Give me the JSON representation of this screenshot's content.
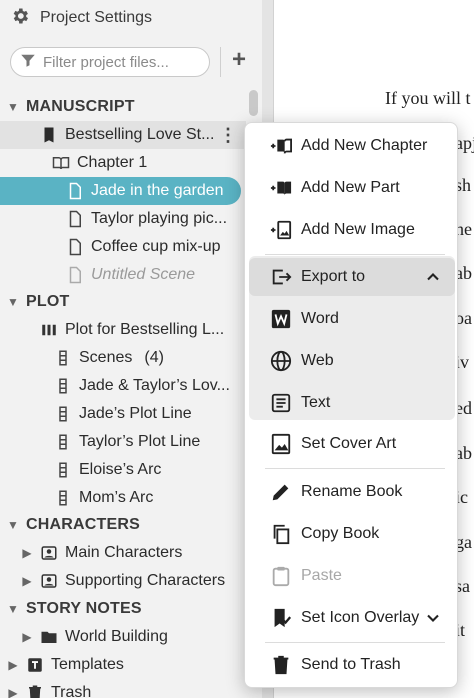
{
  "header": {
    "title": "Project Settings",
    "icon": "gear-icon"
  },
  "filter": {
    "placeholder": "Filter project files...",
    "add_label": "+"
  },
  "tree": {
    "manuscript": {
      "label": "MANUSCRIPT",
      "book": "Bestselling Love St...",
      "chapter": "Chapter 1",
      "scenes": [
        "Jade in the garden",
        "Taylor playing pic...",
        "Coffee cup mix-up",
        "Untitled Scene"
      ]
    },
    "plot": {
      "label": "PLOT",
      "board": "Plot for Bestselling L...",
      "lines": [
        "Scenes",
        "Jade & Taylor’s Lov...",
        "Jade’s Plot Line",
        "Taylor’s Plot Line",
        "Eloise’s Arc",
        "Mom’s Arc"
      ],
      "scenes_count": "(4)"
    },
    "characters": {
      "label": "CHARACTERS",
      "items": [
        "Main Characters",
        "Supporting Characters"
      ]
    },
    "story_notes": {
      "label": "STORY NOTES",
      "items": [
        "World Building"
      ]
    },
    "templates": "Templates",
    "trash": "Trash"
  },
  "document": {
    "lines": [
      "If you will t",
      "apj",
      "sh",
      "he",
      "ab",
      "oa",
      "iv",
      "ed",
      "ab",
      "ic",
      "ga",
      "sa",
      "it"
    ]
  },
  "menu": {
    "items": [
      {
        "label": "Add New Chapter",
        "icon": "add-chapter-icon"
      },
      {
        "label": "Add New Part",
        "icon": "add-part-icon"
      },
      {
        "label": "Add New Image",
        "icon": "add-image-icon"
      },
      {
        "label": "Export to",
        "icon": "export-icon"
      },
      {
        "label": "Word",
        "icon": "word-icon"
      },
      {
        "label": "Web",
        "icon": "globe-icon"
      },
      {
        "label": "Text",
        "icon": "text-doc-icon"
      },
      {
        "label": "Set Cover Art",
        "icon": "image-icon"
      },
      {
        "label": "Rename Book",
        "icon": "pencil-icon"
      },
      {
        "label": "Copy Book",
        "icon": "copy-icon"
      },
      {
        "label": "Paste",
        "icon": "clipboard-icon"
      },
      {
        "label": "Set Icon Overlay",
        "icon": "bookmark-icon"
      },
      {
        "label": "Send to Trash",
        "icon": "trash-icon"
      }
    ]
  },
  "colors": {
    "selection": "#5ab3c4",
    "sidebar_bg": "#f2f2f2"
  }
}
